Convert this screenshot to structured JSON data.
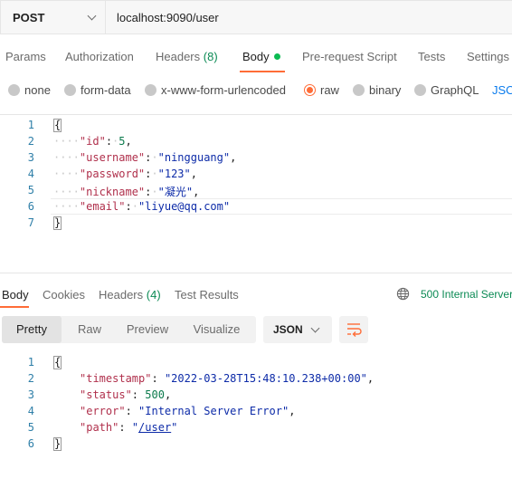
{
  "request": {
    "method": "POST",
    "url": "localhost:9090/user"
  },
  "request_tabs": [
    {
      "label": "Params"
    },
    {
      "label": "Authorization"
    },
    {
      "label": "Headers",
      "count": "(8)"
    },
    {
      "label": "Body",
      "active": true
    },
    {
      "label": "Pre-request Script"
    },
    {
      "label": "Tests"
    },
    {
      "label": "Settings"
    }
  ],
  "body_types": [
    {
      "label": "none"
    },
    {
      "label": "form-data"
    },
    {
      "label": "x-www-form-urlencoded"
    },
    {
      "label": "raw",
      "selected": true
    },
    {
      "label": "binary"
    },
    {
      "label": "GraphQL"
    },
    {
      "label": "JSON"
    }
  ],
  "request_body": {
    "line_numbers": [
      "1",
      "2",
      "3",
      "4",
      "5",
      "6",
      "7"
    ],
    "fields": [
      {
        "key": "\"id\"",
        "value": "5"
      },
      {
        "key": "\"username\"",
        "value": "\"ningguang\""
      },
      {
        "key": "\"password\"",
        "value": "\"123\""
      },
      {
        "key": "\"nickname\"",
        "value": "\"凝光\""
      },
      {
        "key": "\"email\"",
        "value": "\"liyue@qq.com\""
      }
    ]
  },
  "response_tabs": [
    {
      "label": "Body",
      "active": true
    },
    {
      "label": "Cookies"
    },
    {
      "label": "Headers",
      "count": "(4)"
    },
    {
      "label": "Test Results"
    }
  ],
  "response_status": "500 Internal Server",
  "view_modes": [
    {
      "label": "Pretty",
      "active": true
    },
    {
      "label": "Raw"
    },
    {
      "label": "Preview"
    },
    {
      "label": "Visualize"
    }
  ],
  "format": "JSON",
  "response_body": {
    "line_numbers": [
      "1",
      "2",
      "3",
      "4",
      "5",
      "6"
    ],
    "fields": [
      {
        "key": "\"timestamp\"",
        "value": "\"2022-03-28T15:48:10.238+00:00\""
      },
      {
        "key": "\"status\"",
        "value": "500"
      },
      {
        "key": "\"error\"",
        "value": "\"Internal Server Error\""
      },
      {
        "key": "\"path\"",
        "value_prefix": "\"",
        "value_link": "/user",
        "value_suffix": "\""
      }
    ]
  },
  "colors": {
    "accent": "#ff6c37",
    "success_green": "#0b8a54",
    "link_blue": "#097bed"
  },
  "icons": [
    "chevron-down-icon",
    "globe-icon",
    "wrap-lines-icon"
  ]
}
